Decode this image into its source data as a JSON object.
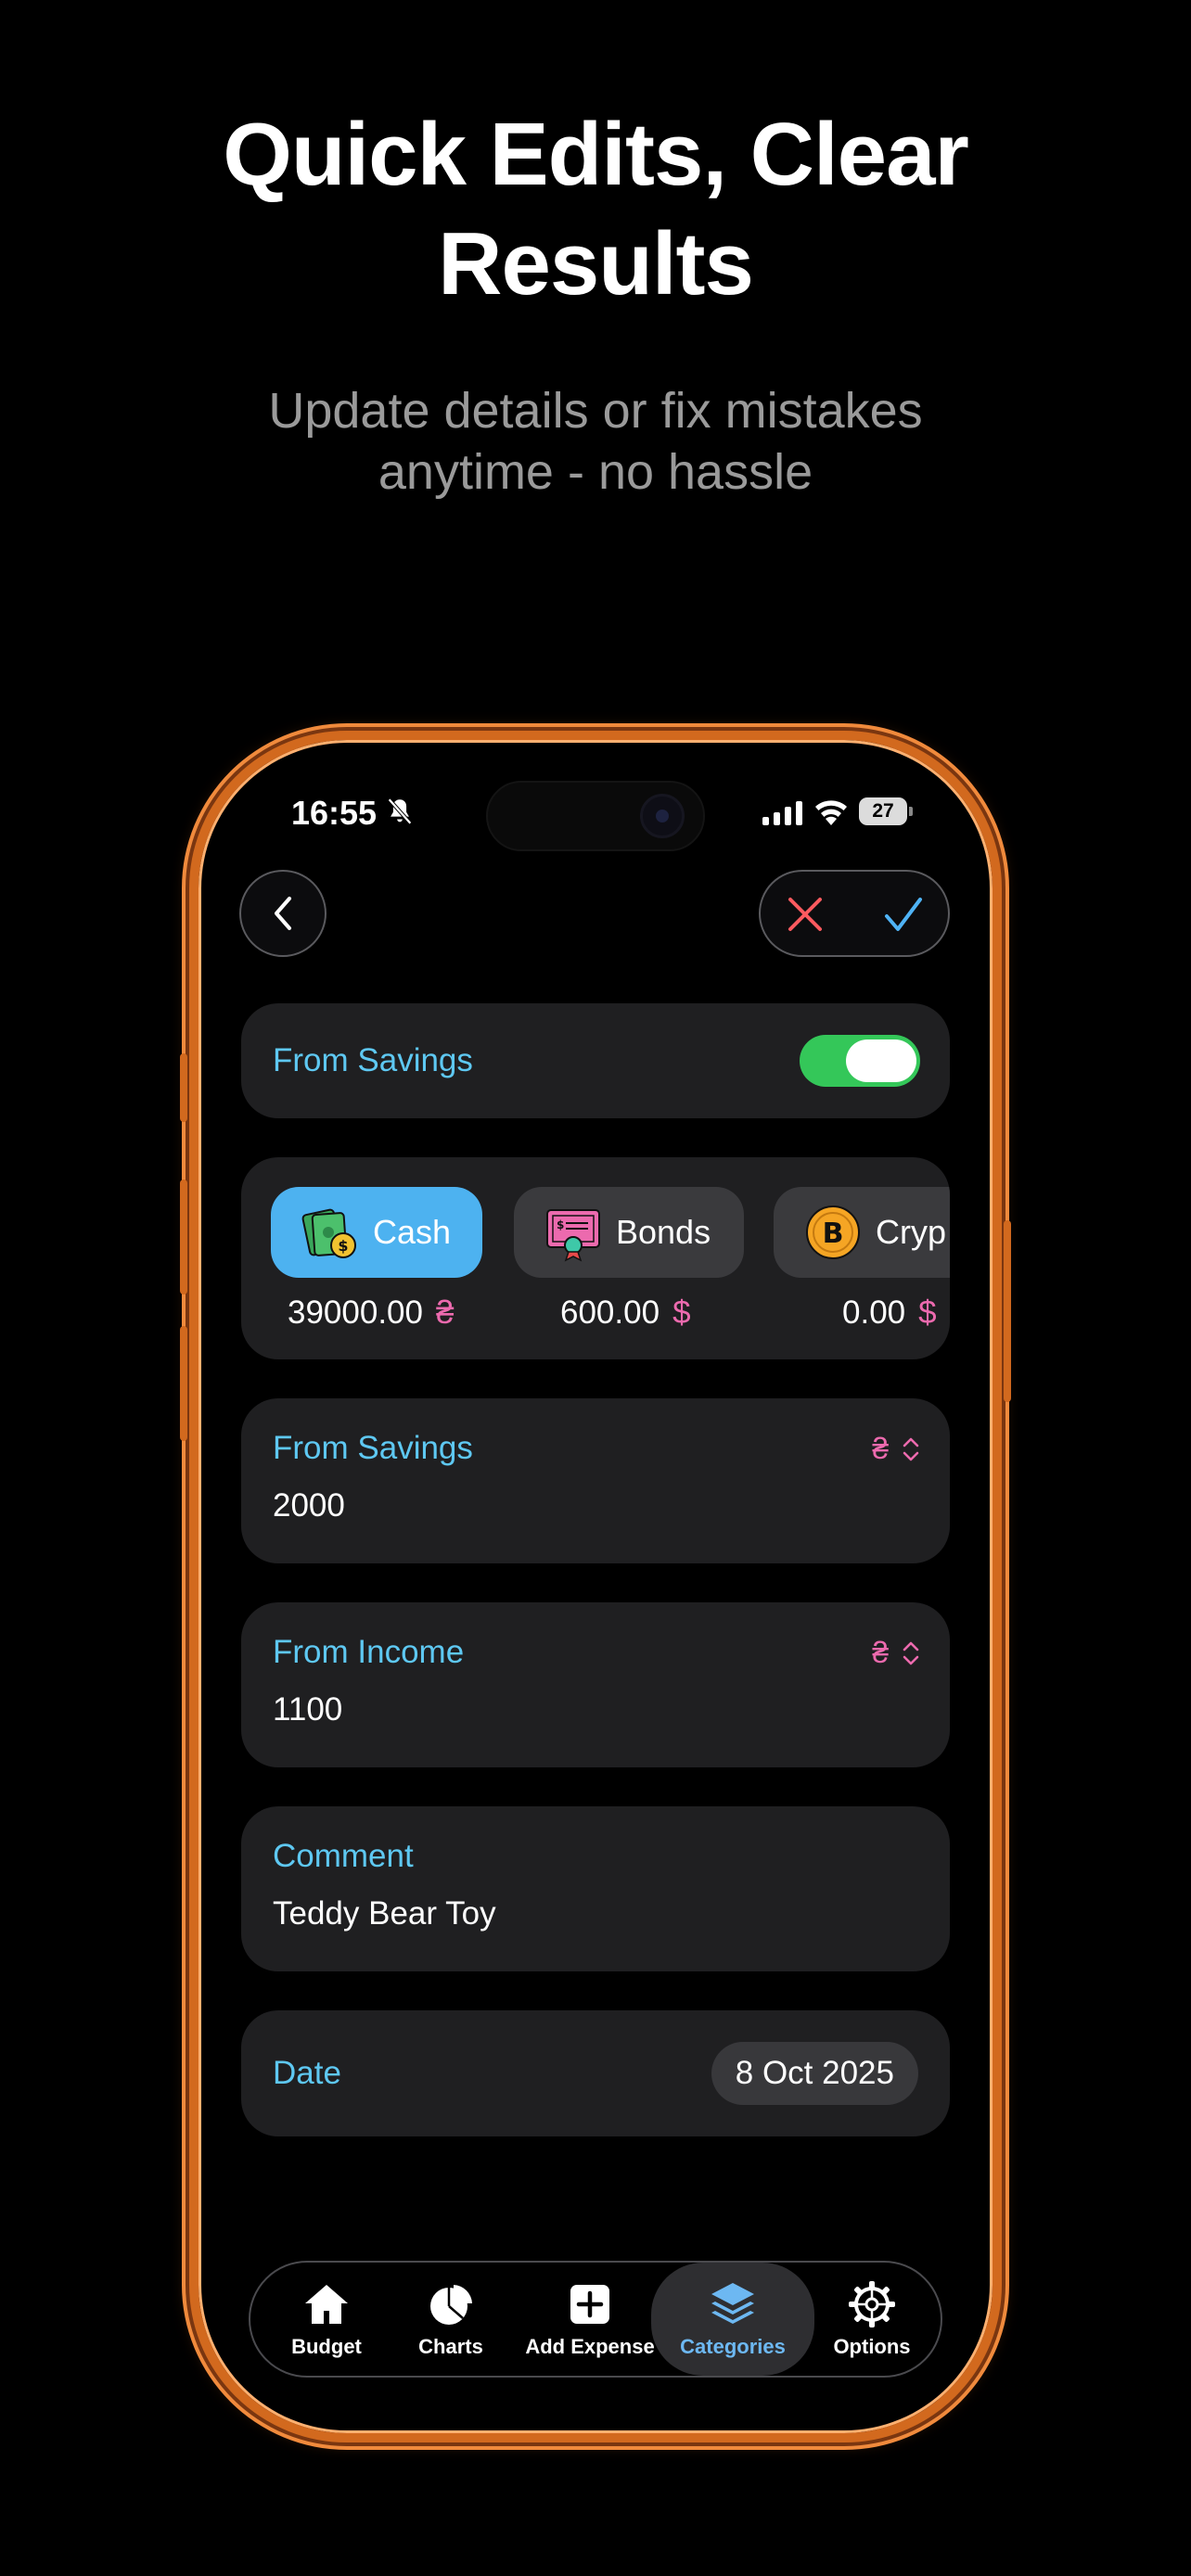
{
  "promo": {
    "headline_line1": "Quick Edits, Clear",
    "headline_line2": "Results",
    "subline_line1": "Update details or fix mistakes",
    "subline_line2": "anytime - no hassle"
  },
  "status_bar": {
    "time": "16:55",
    "battery": "27"
  },
  "form": {
    "toggle": {
      "label": "From Savings",
      "on": true
    },
    "accounts": [
      {
        "name": "Cash",
        "balance": "39000.00",
        "currency": "₴",
        "icon": "cash-icon",
        "selected": true
      },
      {
        "name": "Bonds",
        "balance": "600.00",
        "currency": "$",
        "icon": "bonds-certificate-icon",
        "selected": false
      },
      {
        "name": "Cryp",
        "balance": "0.00",
        "currency": "$",
        "icon": "bitcoin-icon",
        "selected": false
      }
    ],
    "from_savings": {
      "label": "From Savings",
      "value": "2000",
      "currency": "₴"
    },
    "from_income": {
      "label": "From Income",
      "value": "1100",
      "currency": "₴"
    },
    "comment": {
      "label": "Comment",
      "value": "Teddy Bear Toy"
    },
    "date": {
      "label": "Date",
      "value": "8 Oct 2025"
    }
  },
  "tabbar": {
    "items": [
      {
        "label": "Budget",
        "icon": "house-icon"
      },
      {
        "label": "Charts",
        "icon": "pie-chart-icon"
      },
      {
        "label": "Add Expense",
        "icon": "plus-square-icon"
      },
      {
        "label": "Categories",
        "icon": "layers-icon",
        "active": true
      },
      {
        "label": "Options",
        "icon": "gear-icon"
      }
    ]
  },
  "colors": {
    "accent_blue": "#5ec8f2",
    "currency_pink": "#ec6aae",
    "toggle_green": "#34c759",
    "phone_frame": "#d2691e"
  }
}
